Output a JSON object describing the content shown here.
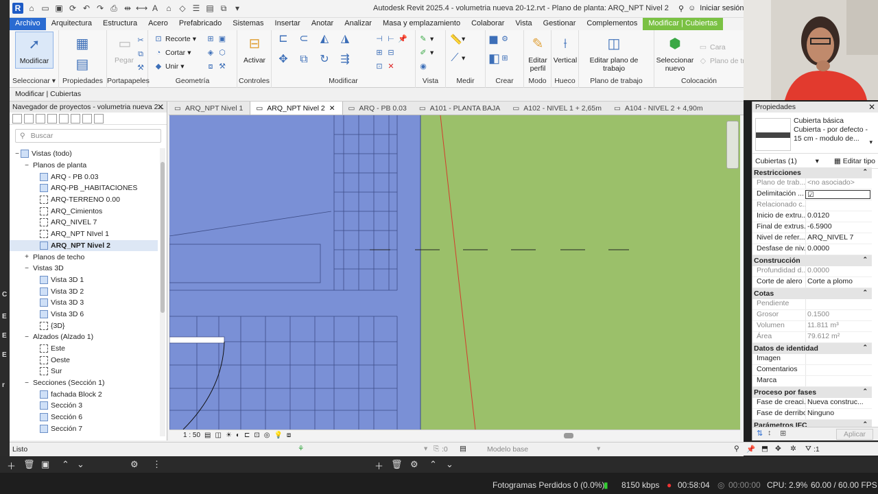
{
  "app": {
    "title": "Autodesk Revit 2025.4 - volumetria nueva 20-12.rvt - Plano de planta: ARQ_NPT Nivel 2",
    "signin": "Iniciar sesión"
  },
  "menu": [
    "Archivo",
    "Arquitectura",
    "Estructura",
    "Acero",
    "Prefabricado",
    "Sistemas",
    "Insertar",
    "Anotar",
    "Analizar",
    "Masa y emplazamiento",
    "Colaborar",
    "Vista",
    "Gestionar",
    "Complementos",
    "Modificar | Cubiertas"
  ],
  "ribbon": {
    "modificar": "Modificar",
    "propiedades": "Propiedades",
    "pegar": "Pegar",
    "recorte": "Recorte",
    "cortar": "Cortar",
    "unir": "Unir",
    "activar": "Activar",
    "editar_perfil": "Editar perfil",
    "vertical": "Vertical",
    "editar_plano": "Editar plano de trabajo",
    "seleccionar_nuevo": "Seleccionar nuevo",
    "cara": "Cara",
    "plano_tra": "Plano de tra",
    "groups": {
      "seleccionar": "Seleccionar",
      "propiedades": "Propiedades",
      "portapapeles": "Portapapeles",
      "geometria": "Geometría",
      "controles": "Controles",
      "modificar": "Modificar",
      "vista": "Vista",
      "medir": "Medir",
      "crear": "Crear",
      "modo": "Modo",
      "hueco": "Hueco",
      "plano_trabajo": "Plano de trabajo",
      "colocacion": "Colocación"
    }
  },
  "optionsbar": "Modificar | Cubiertas",
  "browser": {
    "title": "Navegador de proyectos - volumetria nueva 2...",
    "search_placeholder": "Buscar",
    "tree": [
      {
        "label": "Vistas (todo)",
        "level": 0,
        "exp": "−",
        "icon": "views"
      },
      {
        "label": "Planos de planta",
        "level": 1,
        "exp": "−",
        "icon": "none"
      },
      {
        "label": "ARQ - PB 0.03",
        "level": 2,
        "exp": "",
        "icon": "plan"
      },
      {
        "label": "ARQ-PB _HABITACIONES",
        "level": 2,
        "exp": "",
        "icon": "plan"
      },
      {
        "label": "ARQ-TERRENO 0.00",
        "level": 2,
        "exp": "",
        "icon": "dash"
      },
      {
        "label": "ARQ_Cimientos",
        "level": 2,
        "exp": "",
        "icon": "dash"
      },
      {
        "label": "ARQ_NIVEL 7",
        "level": 2,
        "exp": "",
        "icon": "dash"
      },
      {
        "label": "ARQ_NPT NIvel 1",
        "level": 2,
        "exp": "",
        "icon": "dash"
      },
      {
        "label": "ARQ_NPT Nivel 2",
        "level": 2,
        "exp": "",
        "icon": "plan",
        "selected": true
      },
      {
        "label": "Planos de techo",
        "level": 1,
        "exp": "+",
        "icon": "none"
      },
      {
        "label": "Vistas 3D",
        "level": 1,
        "exp": "−",
        "icon": "none"
      },
      {
        "label": "Vista 3D 1",
        "level": 2,
        "exp": "",
        "icon": "plan"
      },
      {
        "label": "Vista 3D 2",
        "level": 2,
        "exp": "",
        "icon": "plan"
      },
      {
        "label": "Vista 3D 3",
        "level": 2,
        "exp": "",
        "icon": "plan"
      },
      {
        "label": "Vista 3D 6",
        "level": 2,
        "exp": "",
        "icon": "plan"
      },
      {
        "label": "{3D}",
        "level": 2,
        "exp": "",
        "icon": "dash"
      },
      {
        "label": "Alzados (Alzado 1)",
        "level": 1,
        "exp": "−",
        "icon": "none"
      },
      {
        "label": "Este",
        "level": 2,
        "exp": "",
        "icon": "dash"
      },
      {
        "label": "Oeste",
        "level": 2,
        "exp": "",
        "icon": "dash"
      },
      {
        "label": "Sur",
        "level": 2,
        "exp": "",
        "icon": "dash"
      },
      {
        "label": "Secciones (Sección 1)",
        "level": 1,
        "exp": "−",
        "icon": "none"
      },
      {
        "label": "fachada Block 2",
        "level": 2,
        "exp": "",
        "icon": "plan"
      },
      {
        "label": "Sección 3",
        "level": 2,
        "exp": "",
        "icon": "plan"
      },
      {
        "label": "Sección 6",
        "level": 2,
        "exp": "",
        "icon": "plan"
      },
      {
        "label": "Sección 7",
        "level": 2,
        "exp": "",
        "icon": "plan"
      }
    ]
  },
  "tabs": [
    {
      "label": "ARQ_NPT Nivel 1",
      "active": false
    },
    {
      "label": "ARQ_NPT Nivel 2",
      "active": true
    },
    {
      "label": "ARQ - PB 0.03",
      "active": false
    },
    {
      "label": "A101 - PLANTA BAJA",
      "active": false
    },
    {
      "label": "A102 - NIVEL 1 + 2,65m",
      "active": false
    },
    {
      "label": "A104 - NIVEL 2 + 4,90m",
      "active": false
    }
  ],
  "viewctrl": {
    "scale": "1 : 50"
  },
  "status": {
    "text": "Listo",
    "count": ":0",
    "model": "Modelo base",
    "filter": ":1"
  },
  "props": {
    "title": "Propiedades",
    "type_line1": "Cubierta básica",
    "type_line2": "Cubierta - por defecto - 15 cm - modulo de...",
    "filter": "Cubiertas (1)",
    "edit_type": "Editar tipo",
    "apply": "Aplicar",
    "sections": [
      {
        "name": "Restricciones",
        "rows": [
          {
            "k": "Plano de trab...",
            "v": "<no asociado>",
            "dim": true
          },
          {
            "k": "Delimitación ...",
            "v": "☑",
            "dim": false,
            "box": true
          },
          {
            "k": "Relacionado c...",
            "v": "",
            "dim": true
          },
          {
            "k": "Inicio de extru...",
            "v": "0.0120",
            "dim": false
          },
          {
            "k": "Final de extrus...",
            "v": "-6.5900",
            "dim": false
          },
          {
            "k": "Nivel de refer...",
            "v": "ARQ_NIVEL 7",
            "dim": false
          },
          {
            "k": "Desfase de niv...",
            "v": "0.0000",
            "dim": false
          }
        ]
      },
      {
        "name": "Construcción",
        "rows": [
          {
            "k": "Profundidad d...",
            "v": "0.0000",
            "dim": true
          },
          {
            "k": "Corte de alero",
            "v": "Corte a plomo",
            "dim": false
          }
        ]
      },
      {
        "name": "Cotas",
        "rows": [
          {
            "k": "Pendiente",
            "v": "",
            "dim": true
          },
          {
            "k": "Grosor",
            "v": "0.1500",
            "dim": true
          },
          {
            "k": "Volumen",
            "v": "11.811 m³",
            "dim": true
          },
          {
            "k": "Área",
            "v": "79.612 m²",
            "dim": true
          }
        ]
      },
      {
        "name": "Datos de identidad",
        "rows": [
          {
            "k": "Imagen",
            "v": "",
            "dim": false
          },
          {
            "k": "Comentarios",
            "v": "",
            "dim": false
          },
          {
            "k": "Marca",
            "v": "",
            "dim": false
          }
        ]
      },
      {
        "name": "Proceso por fases",
        "rows": [
          {
            "k": "Fase de creaci...",
            "v": "Nueva construc...",
            "dim": false
          },
          {
            "k": "Fase de derribo",
            "v": "Ninguno",
            "dim": false
          }
        ]
      },
      {
        "name": "Parámetros IFC",
        "rows": []
      }
    ]
  },
  "obs": {
    "dropped": "Fotogramas Perdidos 0 (0.0%)",
    "kbps": "8150 kbps",
    "rec_time": "00:58:04",
    "stream_time": "00:00:00",
    "cpu": "CPU: 2.9%",
    "fps": "60.00 / 60.00 FPS"
  },
  "colors": {
    "canvas_green": "#9bc06a",
    "roof_blue": "#7a90d6",
    "accent": "#2a6bd1",
    "context_tab": "#7ac143"
  }
}
